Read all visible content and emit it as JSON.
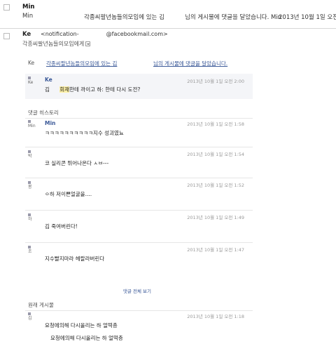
{
  "list_row": {
    "sender": "Min",
    "snippet_sender": "Min",
    "snippet_subject": "각종씨팔년놈들의모임에 있는 김",
    "snippet_body": "님의 게시물에 댓글을 달았습니다. Min",
    "snippet_date": "2013년 10월 1일 오전..."
  },
  "header": {
    "sender": "Ke",
    "email_local": "<notification-",
    "email_domain": "@facebookmail.com>",
    "to": "각종씨팔년놈들의모임에게"
  },
  "notification": {
    "author": "Ke",
    "group_link": "각종씨팔년놈들의모임에 있는 김",
    "post_link": "님의 게시물에 댓글을 달았습니다.",
    "top_comment": {
      "name": "Ke",
      "text_prefix": "김",
      "text_highlight": "회재",
      "text_rest": "한테 까이고 하:   한테 다시 도전?",
      "time": "2013년 10월 1일 오전 2:00",
      "thumb": "Ke"
    },
    "history_title": "댓글 히스토리",
    "history": [
      {
        "name": "Min",
        "thumb": "Min",
        "text": "ㅋㅋㅋㅋㅋㅋㅋㅋㅋㅋ지수 성괴였뇨",
        "time": "2013년 10월 1일 오전 1:58"
      },
      {
        "name": "",
        "thumb": "박",
        "text": "코 실리콘 튀어나온다 ㅅㅂ---",
        "time": "2013년 10월 1일 오전 1:54"
      },
      {
        "name": "",
        "thumb": "봉",
        "text": "ㅇ하 저이쁜얼굴을....",
        "time": "2013년 10월 1일 오전 1:52"
      },
      {
        "name": "",
        "thumb": "하",
        "text": "김   죽여버린다!",
        "time": "2013년 10월 1일 오전 1:49"
      },
      {
        "name": "",
        "thumb": "조",
        "text": "지수빨지마라 헤랄라버린다",
        "time": "2013년 10월 1일 오전 1:47"
      }
    ],
    "show_all": "댓글 전체 보기",
    "original_title": "원래 게시물",
    "original": {
      "thumb": "김",
      "text_1": "요청에의해 다시올리는 하       얼떡층",
      "text_2": "요청에의해 다시올리는 하       얼떡층",
      "time": "2013년 10월 1일 오전 1:18"
    }
  }
}
